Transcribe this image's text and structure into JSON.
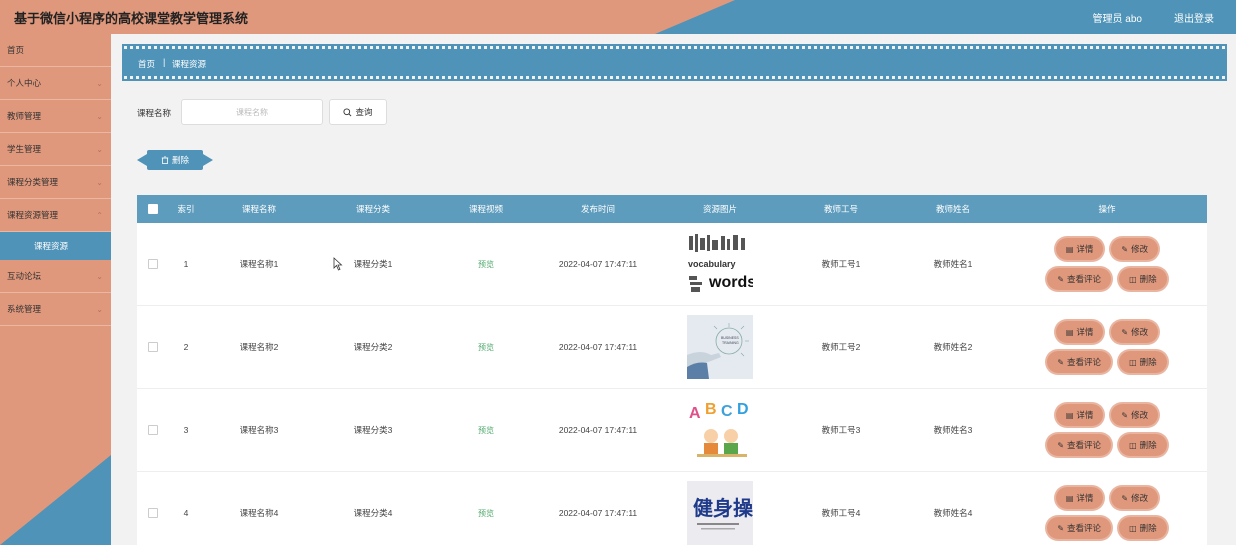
{
  "header": {
    "title": "基于微信小程序的高校课堂教学管理系统",
    "admin": "管理员 abo",
    "logout": "退出登录"
  },
  "sidebar": {
    "items": [
      {
        "label": "首页",
        "has_arrow": false
      },
      {
        "label": "个人中心",
        "has_arrow": true
      },
      {
        "label": "教师管理",
        "has_arrow": true
      },
      {
        "label": "学生管理",
        "has_arrow": true
      },
      {
        "label": "课程分类管理",
        "has_arrow": true
      },
      {
        "label": "课程资源管理",
        "has_arrow": true,
        "expanded": true
      },
      {
        "label": "课程资源",
        "sub": true
      },
      {
        "label": "互动论坛",
        "has_arrow": true
      },
      {
        "label": "系统管理",
        "has_arrow": true
      }
    ]
  },
  "breadcrumb": {
    "home": "首页",
    "separator": "|",
    "current": "课程资源"
  },
  "search": {
    "label": "课程名称",
    "placeholder": "课程名称",
    "button": "查询",
    "button_icon": "search-icon"
  },
  "toolbar": {
    "delete": "删除",
    "delete_icon": "trash-icon"
  },
  "table": {
    "headers": [
      "索引",
      "课程名称",
      "课程分类",
      "课程视频",
      "发布时间",
      "资源图片",
      "教师工号",
      "教师姓名",
      "操作"
    ],
    "rows": [
      {
        "index": "1",
        "name": "课程名称1",
        "category": "课程分类1",
        "video": "预览",
        "time": "2022-04-07 17:47:11",
        "teacher_no": "教师工号1",
        "teacher_name": "教师姓名1",
        "image": "vocabulary-words"
      },
      {
        "index": "2",
        "name": "课程名称2",
        "category": "课程分类2",
        "video": "预览",
        "time": "2022-04-07 17:47:11",
        "teacher_no": "教师工号2",
        "teacher_name": "教师姓名2",
        "image": "business-training"
      },
      {
        "index": "3",
        "name": "课程名称3",
        "category": "课程分类3",
        "video": "预览",
        "time": "2022-04-07 17:47:11",
        "teacher_no": "教师工号3",
        "teacher_name": "教师姓名3",
        "image": "abcd-kids"
      },
      {
        "index": "4",
        "name": "课程名称4",
        "category": "课程分类4",
        "video": "预览",
        "time": "2022-04-07 17:47:11",
        "teacher_no": "教师工号4",
        "teacher_name": "教师姓名4",
        "image": "calligraphy-poster"
      }
    ],
    "ops": {
      "detail": "详情",
      "edit": "修改",
      "comments": "查看评论",
      "delete": "删除"
    },
    "image_text": {
      "vocabulary": "vocabulary",
      "words": "words",
      "business": "BUSINESS",
      "training": "TRAINING",
      "a": "A",
      "b": "B",
      "c": "C",
      "d": "D",
      "calligraphy": "健身操"
    }
  },
  "colors": {
    "peach": "#e0987c",
    "blue": "#4f93b8",
    "table_header": "#5e9cbd",
    "preview_green": "#4ea86b"
  }
}
